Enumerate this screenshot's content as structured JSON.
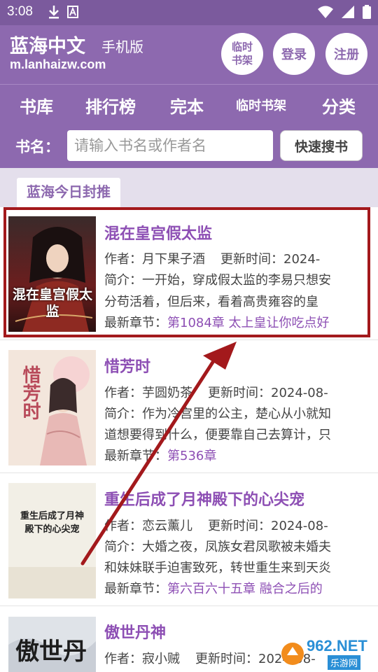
{
  "status": {
    "time": "3:08"
  },
  "header": {
    "site_name": "蓝海中文",
    "site_sub": "手机版",
    "domain": "m.lanhaizw.com",
    "btn_shelf": "临时书架",
    "btn_login": "登录",
    "btn_register": "注册"
  },
  "nav": {
    "items": [
      "书库",
      "排行榜",
      "完本",
      "临时书架",
      "分类"
    ]
  },
  "search": {
    "label": "书名：",
    "placeholder": "请输入书名或作者名",
    "button": "快速搜书"
  },
  "section": {
    "title": "蓝海今日封推"
  },
  "labels": {
    "author": "作者：",
    "updated": "更新时间：",
    "intro": "简介：",
    "latest": "最新章节："
  },
  "books": [
    {
      "title": "混在皇宫假太监",
      "author": "月下果子酒",
      "updated": "2024-",
      "intro_1": "一开始，穿成假太监的李易只想安",
      "intro_2": "分苟活着，但后来，看着高贵雍容的皇",
      "latest": "第1084章 太上皇让你吃点好",
      "cover_text": "混在皇宫假太监"
    },
    {
      "title": "惜芳时",
      "author": "芋圆奶茶",
      "updated": "2024-08-",
      "intro_1": "作为冷宫里的公主，楚心从小就知",
      "intro_2": "道想要得到什么，便要靠自己去算计，只",
      "latest": "第536章",
      "cover_text": "惜芳时"
    },
    {
      "title": "重生后成了月神殿下的心尖宠",
      "author": "恋云薰儿",
      "updated": "2024-08-",
      "intro_1": "大婚之夜，凤族女君凤歌被未婚夫",
      "intro_2": "和妹妹联手迫害致死，转世重生来到天炎",
      "latest": "第六百六十五章 融合之后的",
      "cover_text_1": "重生后成了月神",
      "cover_text_2": "殿下的心尖宠"
    },
    {
      "title": "傲世丹神",
      "author": "寂小贼",
      "updated": "2024-08-",
      "cover_text": "傲世丹神"
    }
  ],
  "watermark": {
    "brand": "962.NET",
    "sub": "乐游网"
  },
  "colors": {
    "header": "#8d69af",
    "status": "#7b5a9d",
    "accent": "#8d4fb4",
    "highlight": "#a3191c",
    "band": "#e4dfec"
  }
}
